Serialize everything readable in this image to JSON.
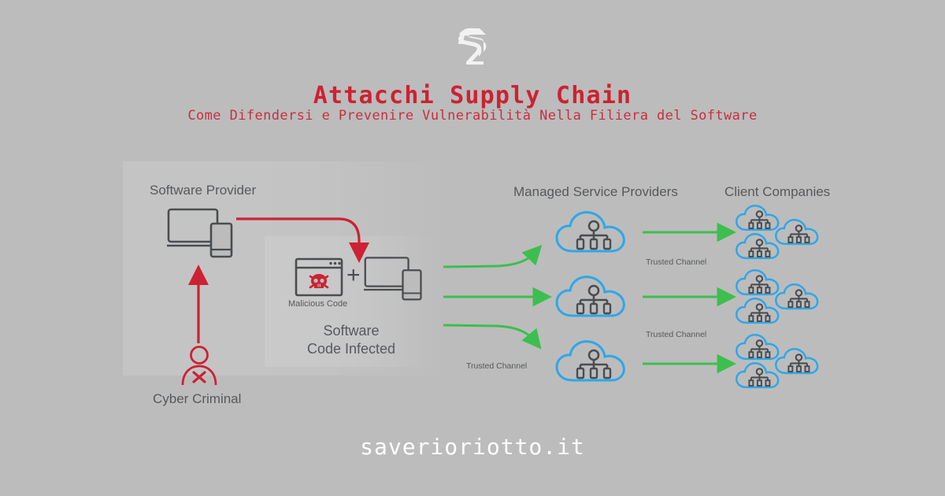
{
  "brand": {
    "logo_icon": "sr-monogram-logo",
    "logo_text": "SR",
    "website": "saverioriotto.it"
  },
  "header": {
    "title": "Attacchi Supply Chain",
    "subtitle": "Come Difendersi e Prevenire Vulnerabilità Nella Filiera del Software"
  },
  "colors": {
    "background": "#bcbcbc",
    "title_red": "#cc2232",
    "subtitle_red": "#c63040",
    "attack_red": "#cc2233",
    "trusted_green": "#3cbf4e",
    "cloud_blue": "#2ea7e8",
    "icon_dark": "#4a4d50",
    "label_gray": "#55585b",
    "white": "#ffffff"
  },
  "diagram": {
    "stages": [
      {
        "id": "software-provider",
        "label": "Software Provider",
        "icon": "laptop-phone-icon"
      },
      {
        "id": "cyber-criminal",
        "label": "Cyber Criminal",
        "icon": "criminal-person-x-icon"
      },
      {
        "id": "software-code-infected",
        "label": "Software\nCode Infected",
        "label_line1": "Software",
        "label_line2": "Code Infected",
        "sub_label": "Malicious Code",
        "sub_icon": "malicious-code-skull-window-icon",
        "operator": "+",
        "icon": "laptop-phone-icon"
      },
      {
        "id": "managed-service-providers",
        "label": "Managed Service Providers",
        "icon": "cloud-network-icon",
        "count": 3
      },
      {
        "id": "client-companies",
        "label": "Client Companies",
        "icon": "cloud-network-icon",
        "groups": 3,
        "clouds_per_group": 3
      }
    ],
    "channel_labels": [
      {
        "id": "trusted-channel-top",
        "text": "Trusted Channel"
      },
      {
        "id": "trusted-channel-middle",
        "text": "Trusted Channel"
      },
      {
        "id": "trusted-channel-bottom",
        "text": "Trusted Channel"
      }
    ],
    "flows": [
      {
        "id": "criminal-to-provider",
        "color": "#cc2233",
        "direction": "up"
      },
      {
        "id": "provider-to-infected-code",
        "color": "#cc2233",
        "direction": "right-down"
      },
      {
        "id": "infected-to-msp-1",
        "color": "#3cbf4e",
        "direction": "right-up"
      },
      {
        "id": "infected-to-msp-2",
        "color": "#3cbf4e",
        "direction": "right"
      },
      {
        "id": "infected-to-msp-3",
        "color": "#3cbf4e",
        "direction": "right-down"
      },
      {
        "id": "msp-to-clients-1",
        "color": "#3cbf4e",
        "direction": "right"
      },
      {
        "id": "msp-to-clients-2",
        "color": "#3cbf4e",
        "direction": "right"
      },
      {
        "id": "msp-to-clients-3",
        "color": "#3cbf4e",
        "direction": "right"
      }
    ]
  }
}
